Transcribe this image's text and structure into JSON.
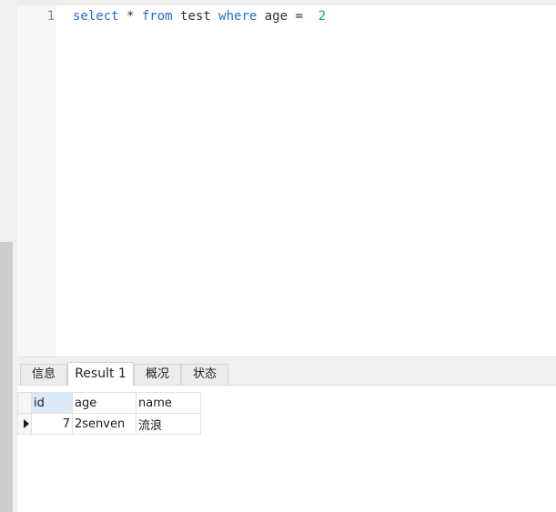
{
  "editor": {
    "line_number": "1",
    "tokens": {
      "t1": "select",
      "t2": " * ",
      "t3": "from",
      "t4": " test ",
      "t5": "where",
      "t6": " age =  ",
      "t7": "2"
    }
  },
  "tabs": [
    {
      "label": "信息"
    },
    {
      "label": "Result 1"
    },
    {
      "label": "概况"
    },
    {
      "label": "状态"
    }
  ],
  "active_tab": "Result 1",
  "grid": {
    "columns": [
      "id",
      "age",
      "name"
    ],
    "rows": [
      {
        "id": "7",
        "age": "2senven",
        "name": "流浪"
      }
    ]
  },
  "colors": {
    "keyword": "#1f6fc9",
    "number": "#10b34a",
    "selected_header": "#dbe9f7"
  }
}
